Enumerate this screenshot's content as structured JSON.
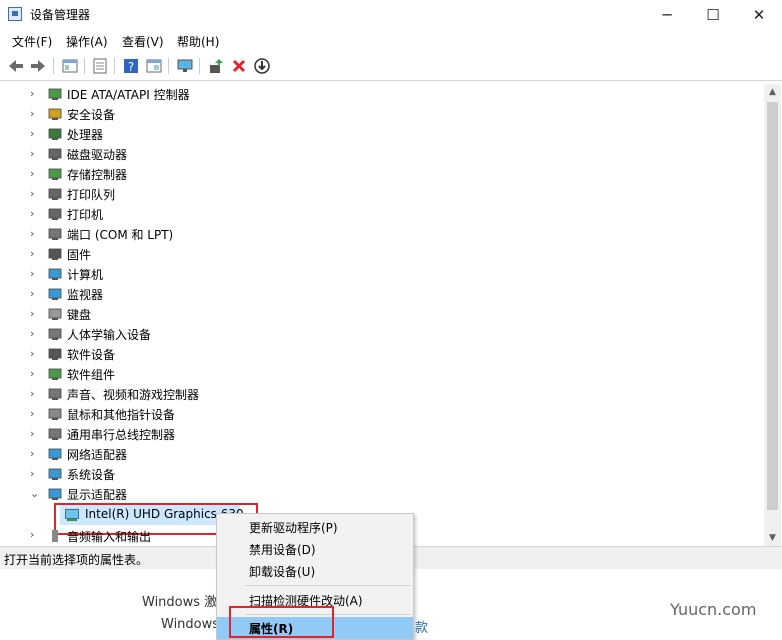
{
  "window": {
    "title": "设备管理器",
    "controls": [
      "─",
      "☐",
      "✕"
    ]
  },
  "menu": [
    "文件(F)",
    "操作(A)",
    "查看(V)",
    "帮助(H)"
  ],
  "toolbar_icons": [
    "back-arrow",
    "forward-arrow",
    "show-hide-tree",
    "properties",
    "help",
    "show-hidden",
    "scan-monitor",
    "update-driver",
    "uninstall",
    "disable"
  ],
  "tree": {
    "items": [
      {
        "label": "IDE ATA/ATAPI 控制器",
        "chev": "›",
        "icon": "ide-icon"
      },
      {
        "label": "安全设备",
        "chev": "›",
        "icon": "security-device-icon"
      },
      {
        "label": "处理器",
        "chev": "›",
        "icon": "processor-icon"
      },
      {
        "label": "磁盘驱动器",
        "chev": "›",
        "icon": "disk-drive-icon"
      },
      {
        "label": "存储控制器",
        "chev": "›",
        "icon": "storage-controller-icon"
      },
      {
        "label": "打印队列",
        "chev": "›",
        "icon": "print-queue-icon"
      },
      {
        "label": "打印机",
        "chev": "›",
        "icon": "printer-icon"
      },
      {
        "label": "端口 (COM 和 LPT)",
        "chev": "›",
        "icon": "port-icon"
      },
      {
        "label": "固件",
        "chev": "›",
        "icon": "firmware-icon"
      },
      {
        "label": "计算机",
        "chev": "›",
        "icon": "computer-icon"
      },
      {
        "label": "监视器",
        "chev": "›",
        "icon": "monitor-icon"
      },
      {
        "label": "键盘",
        "chev": "›",
        "icon": "keyboard-icon"
      },
      {
        "label": "人体学输入设备",
        "chev": "›",
        "icon": "hid-icon"
      },
      {
        "label": "软件设备",
        "chev": "›",
        "icon": "software-device-icon"
      },
      {
        "label": "软件组件",
        "chev": "›",
        "icon": "software-component-icon"
      },
      {
        "label": "声音、视频和游戏控制器",
        "chev": "›",
        "icon": "sound-icon"
      },
      {
        "label": "鼠标和其他指针设备",
        "chev": "›",
        "icon": "mouse-icon"
      },
      {
        "label": "通用串行总线控制器",
        "chev": "›",
        "icon": "usb-icon"
      },
      {
        "label": "网络适配器",
        "chev": "›",
        "icon": "network-adapter-icon"
      },
      {
        "label": "系统设备",
        "chev": "›",
        "icon": "system-device-icon"
      },
      {
        "label": "显示适配器",
        "chev": "⌄",
        "icon": "display-adapter-icon"
      }
    ],
    "child": {
      "label": "Intel(R) UHD Graphics 630",
      "icon": "display-adapter-icon"
    },
    "partial": {
      "label": "音频输入和输出",
      "chev": "›"
    }
  },
  "status": "打开当前选择项的属性表。",
  "background_text": {
    "line1": "Windows 激",
    "line2": "Windows",
    "line2_tail": "款"
  },
  "context_menu": {
    "items": [
      "更新驱动程序(P)",
      "禁用设备(D)",
      "卸载设备(U)",
      "扫描检测硬件改动(A)",
      "属性(R)"
    ]
  },
  "watermark": "Yuucn.com",
  "colors": {
    "highlight_red": "#e0242a",
    "selected_bg": "#cce8ff",
    "ctx_hover": "#91c9f7"
  }
}
